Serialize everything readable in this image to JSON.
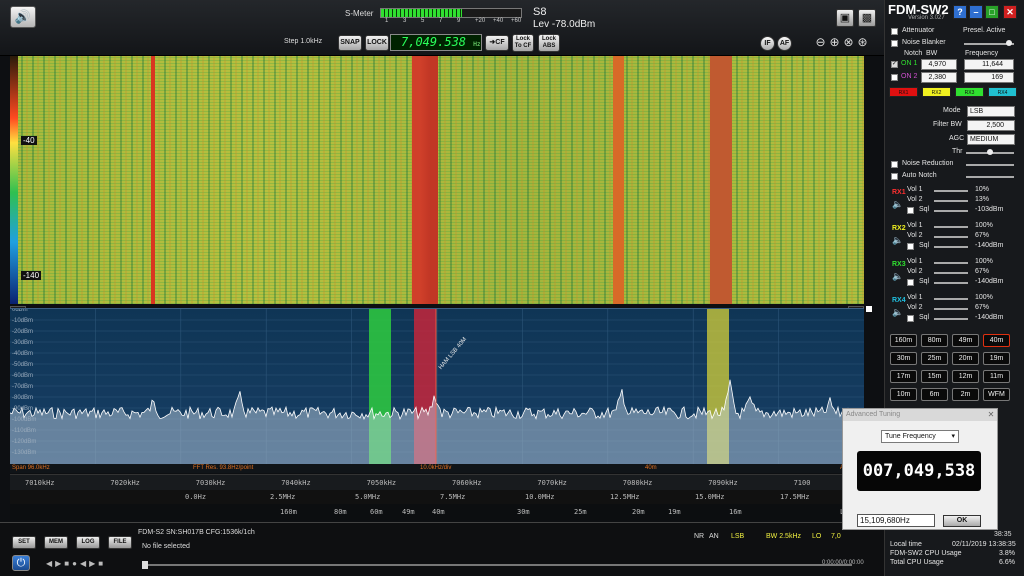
{
  "app": {
    "title": "FDM-SW2",
    "version": "Version 3.027"
  },
  "topbar": {
    "smeter_label": "S-Meter",
    "smeter_scale": [
      "1",
      "3",
      "5",
      "7",
      "9",
      "+20",
      "+40",
      "+60"
    ],
    "smeter_level": 0.58,
    "s_value": "S8",
    "level": "Lev -78.0dBm",
    "step": "Step 1.0kHz",
    "snap": "SNAP",
    "lock": "LOCK",
    "frequency": "7,049.538",
    "freq_unit": "Hz",
    "to_cf": "CF",
    "lock_to_cf_1": "Lock",
    "lock_to_cf_2": "To CF",
    "lock_abs_1": "Lock",
    "lock_abs_2": "ABS",
    "if_btn": "IF",
    "af_btn": "AF"
  },
  "waterfall": {
    "label_top": "-40",
    "label_bottom": "-140"
  },
  "spectrum": {
    "db_labels": [
      "0dBm",
      "-10dBm",
      "-20dBm",
      "-30dBm",
      "-40dBm",
      "-50dBm",
      "-60dBm",
      "-70dBm",
      "-80dBm",
      "-90dBm",
      "-100dBm",
      "-110dBm",
      "-120dBm",
      "-130dBm"
    ],
    "marker_label": "HAM LSB 40M",
    "bands": [
      {
        "color": "#2ecc40",
        "opacity": 0.85
      },
      {
        "color": "#d0253a",
        "opacity": 0.8
      },
      {
        "color": "#d6d23a",
        "opacity": 0.75
      }
    ]
  },
  "info_strip": {
    "span": "Span 96.0kHz",
    "fft": "FFT Res. 93.8Hz/point",
    "div": "10.0kHz/div",
    "band": "40m",
    "a": "A"
  },
  "freq_scale": [
    "7010kHz",
    "7020kHz",
    "7030kHz",
    "7040kHz",
    "7050kHz",
    "7060kHz",
    "7070kHz",
    "7080kHz",
    "7090kHz",
    "7100"
  ],
  "mhz_scale": [
    "0.0Hz",
    "2.5MHz",
    "5.0MHz",
    "7.5MHz",
    "10.0MHz",
    "12.5MHz",
    "15.0MHz",
    "17.5MHz"
  ],
  "band_scale": [
    "160m",
    "80m",
    "60m",
    "49m",
    "40m",
    "30m",
    "25m",
    "20m",
    "19m",
    "16m",
    "LO"
  ],
  "bottom": {
    "set": "SET",
    "mem": "MEM",
    "log": "LOG",
    "file": "FILE",
    "device": "FDM-S2 SN:SH017B CFG:1536k/1ch",
    "file_status": "No file selected",
    "nr": "NR",
    "an": "AN",
    "mode": "LSB",
    "bw": "BW 2.5kHz",
    "lo": "LO",
    "lo_val": "7,0",
    "time_pos": "0:00:00/0:00:00"
  },
  "panel": {
    "attenuator": "Attenuator",
    "presel": "Presel. Active",
    "noise_blanker": "Noise Blanker",
    "notch_hdr": "Notch",
    "bw_hdr": "BW",
    "freq_hdr": "Frequency",
    "notch1": {
      "label": "ON 1",
      "bw": "4,970",
      "freq": "11,644"
    },
    "notch2": {
      "label": "ON 2",
      "bw": "2,380",
      "freq": "169"
    },
    "rx_tabs": [
      {
        "label": "RX1",
        "color": "#e01010"
      },
      {
        "label": "RX2",
        "color": "#f0f020"
      },
      {
        "label": "RX3",
        "color": "#30e030"
      },
      {
        "label": "RX4",
        "color": "#20c0d0"
      }
    ],
    "mode_label": "Mode",
    "mode_val": "LSB",
    "filter_label": "Filter BW",
    "filter_val": "2,500",
    "agc_label": "AGC",
    "agc_val": "MEDIUM",
    "thr_label": "Thr",
    "noise_reduction": "Noise Reduction",
    "auto_notch": "Auto Notch",
    "receivers": [
      {
        "name": "RX1",
        "color": "#ff3030",
        "vol1": "10%",
        "vol2": "13%",
        "sql": "-103dBm"
      },
      {
        "name": "RX2",
        "color": "#f0f020",
        "vol1": "100%",
        "vol2": "67%",
        "sql": "-140dBm"
      },
      {
        "name": "RX3",
        "color": "#30e030",
        "vol1": "100%",
        "vol2": "67%",
        "sql": "-140dBm"
      },
      {
        "name": "RX4",
        "color": "#20c0e0",
        "vol1": "100%",
        "vol2": "67%",
        "sql": "-140dBm"
      }
    ],
    "vol1_label": "Vol 1",
    "vol2_label": "Vol 2",
    "sql_label": "Sql",
    "bands": [
      "160m",
      "80m",
      "49m",
      "40m",
      "30m",
      "25m",
      "20m",
      "19m",
      "17m",
      "15m",
      "12m",
      "11m",
      "10m",
      "6m",
      "2m",
      "WFM"
    ],
    "active_band": "40m",
    "local_time_label": "Local time",
    "local_time": "02/11/2019 13:38:35",
    "utc_time": "38:35",
    "fdm_cpu_label": "FDM-SW2 CPU Usage",
    "fdm_cpu": "3.8%",
    "total_cpu_label": "Total CPU Usage",
    "total_cpu": "6.6%"
  },
  "advanced": {
    "title": "Advanced Tuning",
    "dropdown": "Tune Frequency",
    "frequency": "007,049,538",
    "input": "15,109,680Hz",
    "ok": "OK"
  }
}
